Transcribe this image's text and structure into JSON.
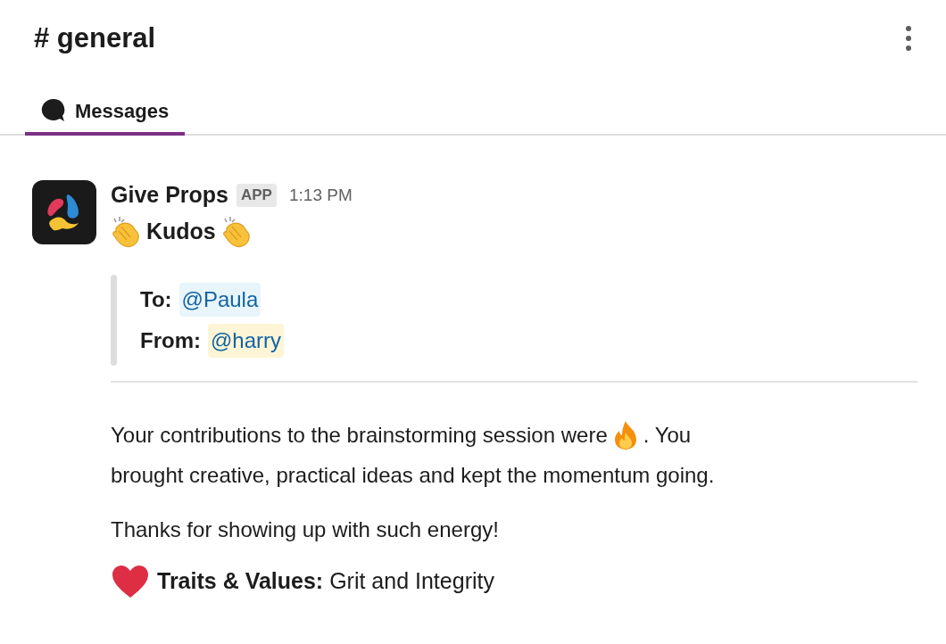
{
  "channel": {
    "title": "# general"
  },
  "tabs": [
    {
      "label": "Messages",
      "selected": true
    }
  ],
  "message": {
    "sender": "Give Props",
    "badge": "APP",
    "time": "1:13 PM",
    "heading": "Kudos",
    "fields": [
      {
        "label": "To:",
        "mention": "@Paula",
        "color": "#e8f5fa"
      },
      {
        "label": "From:",
        "mention": "@harry",
        "color": "#fdf5d5"
      }
    ],
    "body": [
      {
        "kind": "fire_sentence",
        "before": "Your contributions to the brainstorming session were",
        "after": ". You",
        "continuation": "brought creative, practical ideas and kept the momentum going."
      },
      {
        "kind": "text",
        "text": "Thanks for showing up with such energy!"
      }
    ],
    "traits": "**Traits & Values:** Grit and Integrity"
  }
}
